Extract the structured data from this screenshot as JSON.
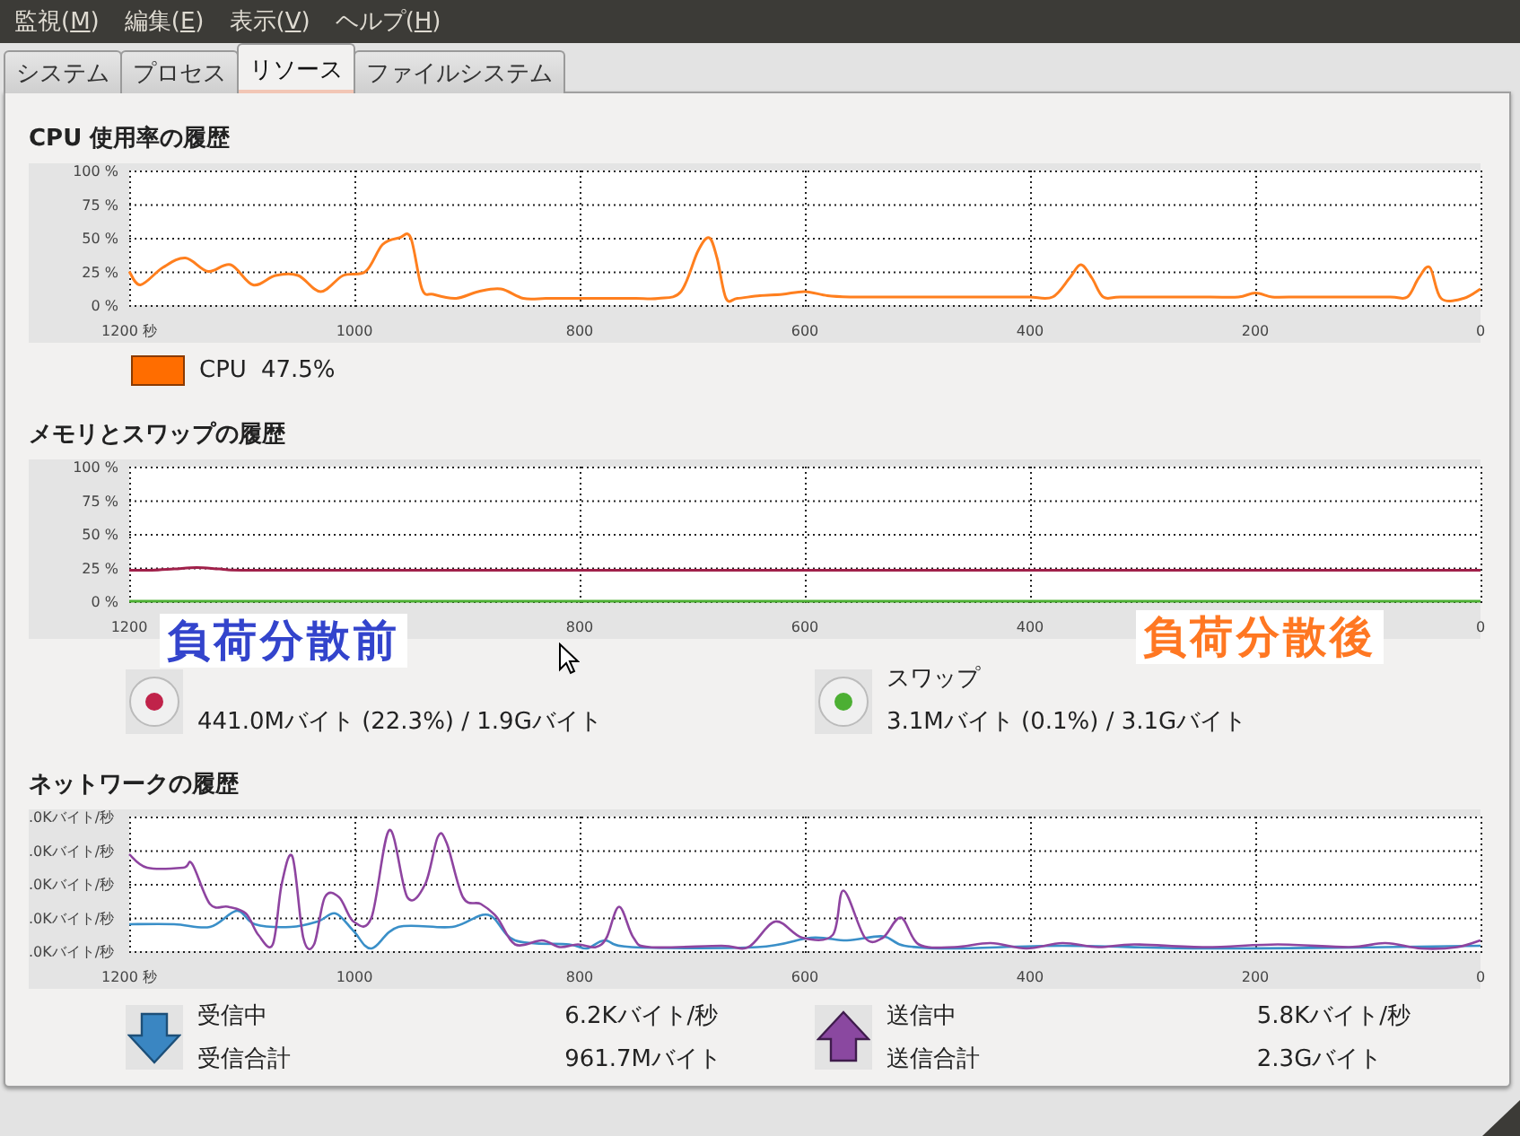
{
  "menu": [
    {
      "before": "監視(",
      "mnemonic": "M",
      "after": ")"
    },
    {
      "before": "編集(",
      "mnemonic": "E",
      "after": ")"
    },
    {
      "before": "表示(",
      "mnemonic": "V",
      "after": ")"
    },
    {
      "before": "ヘルプ(",
      "mnemonic": "H",
      "after": ")"
    }
  ],
  "tabs": [
    {
      "label": "システム",
      "selected": false
    },
    {
      "label": "プロセス",
      "selected": false
    },
    {
      "label": "リソース",
      "selected": true
    },
    {
      "label": "ファイルシステム",
      "selected": false
    }
  ],
  "cpu": {
    "title": "CPU 使用率の履歴",
    "chart_data": {
      "type": "line",
      "x": [
        1200,
        1190,
        1170,
        1150,
        1130,
        1110,
        1090,
        1070,
        1050,
        1030,
        1010,
        990,
        975,
        960,
        950,
        940,
        930,
        910,
        890,
        870,
        850,
        830,
        810,
        790,
        770,
        750,
        730,
        710,
        695,
        685,
        678,
        670,
        660,
        640,
        620,
        600,
        580,
        560,
        540,
        500,
        460,
        420,
        400,
        380,
        365,
        355,
        345,
        335,
        320,
        280,
        240,
        215,
        200,
        185,
        170,
        120,
        80,
        65,
        55,
        45,
        35,
        15,
        0
      ],
      "series": [
        {
          "color": "#ff7f1e",
          "values": [
            25,
            15,
            28,
            35,
            25,
            30,
            15,
            22,
            22,
            10,
            22,
            25,
            45,
            50,
            50,
            12,
            8,
            5,
            10,
            12,
            5,
            5,
            5,
            5,
            5,
            5,
            5,
            10,
            40,
            50,
            35,
            5,
            5,
            7,
            8,
            10,
            7,
            6,
            6,
            6,
            6,
            6,
            6,
            6,
            20,
            30,
            20,
            6,
            6,
            6,
            6,
            6,
            9,
            6,
            6,
            6,
            6,
            6,
            20,
            28,
            5,
            5,
            12
          ]
        }
      ],
      "grid": true,
      "xlim": [
        1200,
        0
      ],
      "ylim": [
        0,
        100
      ],
      "xticks": [
        {
          "value": 1200,
          "label": "1200 秒"
        },
        1000,
        800,
        600,
        400,
        200,
        0
      ],
      "yticks": [
        {
          "value": 0,
          "label": "0 %"
        },
        {
          "value": 25,
          "label": "25 %"
        },
        {
          "value": 50,
          "label": "50 %"
        },
        {
          "value": 75,
          "label": "75 %"
        },
        {
          "value": 100,
          "label": "100 %"
        }
      ]
    },
    "legend": [
      {
        "label": "CPU",
        "value": "47.5%",
        "color": "#ff6d00"
      }
    ]
  },
  "memory": {
    "title": "メモリとスワップの履歴",
    "chart_data": {
      "type": "line",
      "x": [
        1200,
        1180,
        1160,
        1140,
        1120,
        1100,
        1000,
        800,
        600,
        400,
        200,
        0
      ],
      "series": [
        {
          "color": "#a0204a",
          "values": [
            23,
            23,
            24,
            25,
            24,
            23,
            23,
            23,
            23,
            23,
            23,
            23
          ]
        },
        {
          "color": "#4caf33",
          "values": [
            0,
            0,
            0,
            0,
            0,
            0,
            0,
            0,
            0,
            0,
            0,
            0
          ]
        }
      ],
      "grid": true,
      "xlim": [
        1200,
        0
      ],
      "ylim": [
        0,
        100
      ],
      "xticks": [
        {
          "value": 1200,
          "label": "1200"
        },
        800,
        600,
        400,
        0
      ],
      "yticks": [
        {
          "value": 0,
          "label": "0 %"
        },
        {
          "value": 25,
          "label": "25 %"
        },
        {
          "value": 50,
          "label": "50 %"
        },
        {
          "value": 75,
          "label": "75 %"
        },
        {
          "value": 100,
          "label": "100 %"
        }
      ]
    },
    "legend": [
      {
        "value": "441.0Mバイト (22.3%) / 1.9Gバイト",
        "color": "#c0234a"
      },
      {
        "label": "スワップ",
        "value": "3.1Mバイト (0.1%) / 3.1Gバイト",
        "color": "#4caf33"
      }
    ]
  },
  "network": {
    "title": "ネットワークの履歴",
    "y_labels": [
      ".0Kバイト/秒",
      ".0Kバイト/秒",
      ".0Kバイト/秒",
      ".0Kバイト/秒",
      ".0Kバイト/秒"
    ],
    "x_labels": [
      "1200 秒",
      "1000",
      "800",
      "600",
      "400",
      "200",
      "0"
    ],
    "legend": [
      {
        "kind": "receive",
        "rows": [
          {
            "label": "受信中",
            "value": "6.2Kバイト/秒"
          },
          {
            "label": "受信合計",
            "value": "961.7Mバイト"
          }
        ]
      },
      {
        "kind": "send",
        "rows": [
          {
            "label": "送信中",
            "value": "5.8Kバイト/秒"
          },
          {
            "label": "送信合計",
            "value": "2.3Gバイト"
          }
        ]
      }
    ]
  },
  "annotations": [
    {
      "text": "負荷分散前",
      "color": "#3344cc"
    },
    {
      "text": "負荷分散後",
      "color": "#ff7722"
    }
  ]
}
